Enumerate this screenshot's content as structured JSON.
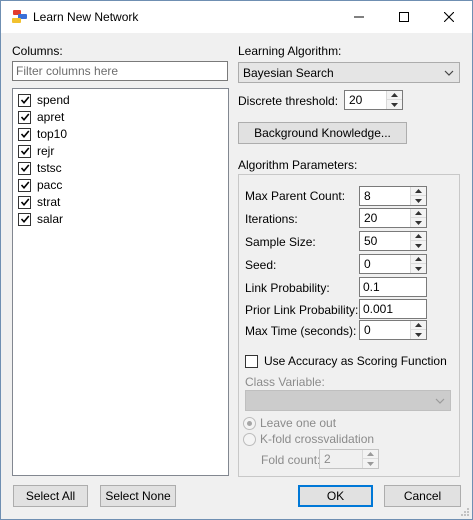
{
  "window": {
    "title": "Learn New Network",
    "minimize_icon": "minimize-icon",
    "maximize_icon": "maximize-icon",
    "close_icon": "close-icon"
  },
  "columns": {
    "label": "Columns:",
    "filter_placeholder": "Filter columns here",
    "items": [
      {
        "label": "spend",
        "checked": true
      },
      {
        "label": "apret",
        "checked": true
      },
      {
        "label": "top10",
        "checked": true
      },
      {
        "label": "rejr",
        "checked": true
      },
      {
        "label": "tstsc",
        "checked": true
      },
      {
        "label": "pacc",
        "checked": true
      },
      {
        "label": "strat",
        "checked": true
      },
      {
        "label": "salar",
        "checked": true
      }
    ],
    "select_all_label": "Select All",
    "select_none_label": "Select None"
  },
  "algorithm": {
    "label": "Learning Algorithm:",
    "selected": "Bayesian Search",
    "discrete_threshold_label": "Discrete threshold:",
    "discrete_threshold_value": "20",
    "background_knowledge_label": "Background Knowledge..."
  },
  "params": {
    "label": "Algorithm Parameters:",
    "max_parent_count_label": "Max Parent Count:",
    "max_parent_count_value": "8",
    "iterations_label": "Iterations:",
    "iterations_value": "20",
    "sample_size_label": "Sample Size:",
    "sample_size_value": "50",
    "seed_label": "Seed:",
    "seed_value": "0",
    "link_probability_label": "Link Probability:",
    "link_probability_value": "0.1",
    "prior_link_probability_label": "Prior Link Probability:",
    "prior_link_probability_value": "0.001",
    "max_time_label": "Max Time (seconds):",
    "max_time_value": "0",
    "use_accuracy_label": "Use Accuracy as Scoring Function",
    "use_accuracy_checked": false,
    "class_variable_label": "Class Variable:",
    "class_variable_value": "",
    "leave_one_out_label": "Leave one out",
    "kfold_label": "K-fold crossvalidation",
    "fold_count_label": "Fold count:",
    "fold_count_value": "2"
  },
  "footer": {
    "ok_label": "OK",
    "cancel_label": "Cancel"
  },
  "colors": {
    "accent": "#0078d7",
    "check": "#000000"
  }
}
